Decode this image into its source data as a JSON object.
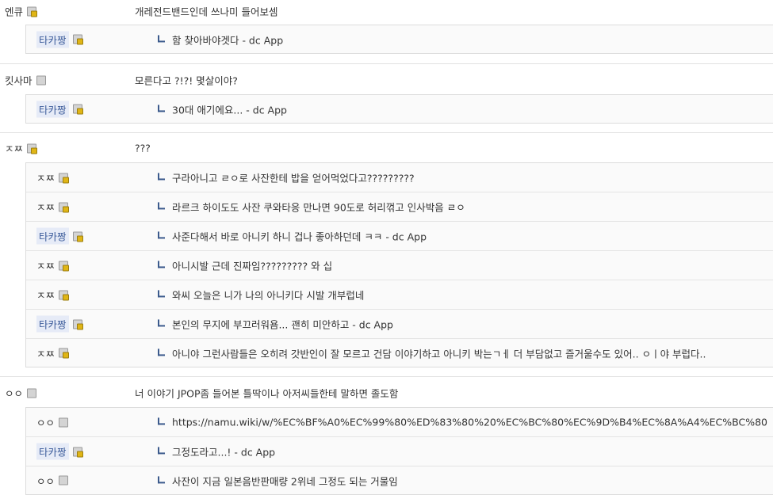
{
  "threads": [
    {
      "nick": "엔큐",
      "icon": "gold",
      "text": "개레전드밴드인데 쓰나미 들어보셈",
      "replies": [
        {
          "nick": "타카짱",
          "badge": true,
          "icon": "gold",
          "text": "함 찾아바야겟다 - dc App"
        }
      ]
    },
    {
      "nick": "킷사마",
      "icon": "gray",
      "text": "모른다고 ?!?! 몇살이야?",
      "replies": [
        {
          "nick": "타카짱",
          "badge": true,
          "icon": "gold",
          "text": "30대 애기에요... - dc App"
        }
      ]
    },
    {
      "nick": "ㅈㅉ",
      "icon": "gold",
      "text": "???",
      "replies": [
        {
          "nick": "ㅈㅉ",
          "badge": false,
          "icon": "gold",
          "text": "구라아니고 ㄹㅇ로 사잔한테 밥을 얻어먹었다고?????????"
        },
        {
          "nick": "ㅈㅉ",
          "badge": false,
          "icon": "gold",
          "text": "라르크 하이도도 사잔 쿠와타응 만나면 90도로 허리꺾고 인사박음 ㄹㅇ"
        },
        {
          "nick": "타카짱",
          "badge": true,
          "icon": "gold",
          "text": "사준다해서 바로 아니키 하니 겁나 좋아하던데 ㅋㅋ - dc App"
        },
        {
          "nick": "ㅈㅉ",
          "badge": false,
          "icon": "gold",
          "text": "아니시발 근데 진짜임????????? 와 십"
        },
        {
          "nick": "ㅈㅉ",
          "badge": false,
          "icon": "gold",
          "text": "와씨 오늘은 니가 나의 아니키다 시발 개부럽네"
        },
        {
          "nick": "타카짱",
          "badge": true,
          "icon": "gold",
          "text": "본인의 무지에 부끄러워욤... 괜히 미안하고 - dc App"
        },
        {
          "nick": "ㅈㅉ",
          "badge": false,
          "icon": "gold",
          "text": "아니야 그런사람들은 오히려 갓반인이 잘 모르고 건담 이야기하고 아니키 박는ㄱㅔ 더 부담없고 즐거울수도 있어.. ㅇㅣ야 부럽다.."
        }
      ]
    },
    {
      "nick": "ㅇㅇ",
      "icon": "gray",
      "text": "너 이야기 JPOP좀 들어본 틀딱이나 아저씨들한테 말하면 졸도함",
      "replies": [
        {
          "nick": "ㅇㅇ",
          "badge": false,
          "icon": "gray",
          "text": "https://namu.wiki/w/%EC%BF%A0%EC%99%80%ED%83%80%20%EC%BC%80%EC%9D%B4%EC%8A%A4%EC%BC%80"
        },
        {
          "nick": "타카짱",
          "badge": true,
          "icon": "gold",
          "text": "그정도라고...! - dc App"
        },
        {
          "nick": "ㅇㅇ",
          "badge": false,
          "icon": "gray",
          "text": "사잔이 지금 일본음반판매량 2위네 그정도 되는 거물임"
        }
      ]
    }
  ]
}
